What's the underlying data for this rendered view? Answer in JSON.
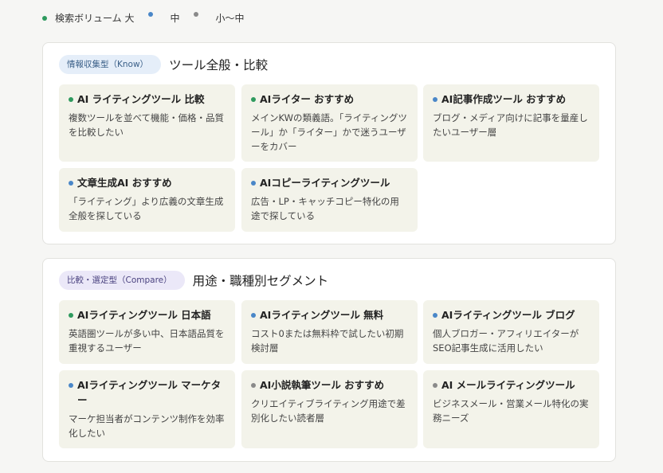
{
  "colors": {
    "large": "#2e9a5e",
    "medium": "#4a87c8",
    "small": "#8a8a8a"
  },
  "legend": {
    "items": [
      {
        "label": "検索ボリューム 大",
        "level": "large"
      },
      {
        "label": "中",
        "level": "medium"
      },
      {
        "label": "小〜中",
        "level": "small"
      }
    ]
  },
  "sections": [
    {
      "badge": "情報収集型（Know）",
      "title": "ツール全般・比較",
      "cards": [
        {
          "title": "AI ライティングツール 比較",
          "desc": "複数ツールを並べて機能・価格・品質を比較したい",
          "level": "large"
        },
        {
          "title": "AIライター おすすめ",
          "desc": "メインKWの類義語。「ライティングツール」か「ライター」かで迷うユーザーをカバー",
          "level": "large"
        },
        {
          "title": "AI記事作成ツール おすすめ",
          "desc": "ブログ・メディア向けに記事を量産したいユーザー層",
          "level": "medium"
        },
        {
          "title": "文章生成AI おすすめ",
          "desc": "「ライティング」より広義の文章生成全般を探している",
          "level": "medium"
        },
        {
          "title": "AIコピーライティングツール",
          "desc": "広告・LP・キャッチコピー特化の用途で探している",
          "level": "medium"
        }
      ]
    },
    {
      "badge": "比較・選定型（Compare）",
      "title": "用途・職種別セグメント",
      "cards": [
        {
          "title": "AIライティングツール 日本語",
          "desc": "英語圏ツールが多い中、日本語品質を重視するユーザー",
          "level": "large"
        },
        {
          "title": "AIライティングツール 無料",
          "desc": "コスト0または無料枠で試したい初期検討層",
          "level": "medium"
        },
        {
          "title": "AIライティングツール ブログ",
          "desc": "個人ブロガー・アフィリエイターがSEO記事生成に活用したい",
          "level": "medium"
        },
        {
          "title": "AIライティングツール マーケター",
          "desc": "マーケ担当者がコンテンツ制作を効率化したい",
          "level": "medium"
        },
        {
          "title": "AI小説執筆ツール おすすめ",
          "desc": "クリエイティブライティング用途で差別化したい読者層",
          "level": "small"
        },
        {
          "title": "AI メールライティングツール",
          "desc": "ビジネスメール・営業メール特化の実務ニーズ",
          "level": "small"
        }
      ]
    }
  ]
}
